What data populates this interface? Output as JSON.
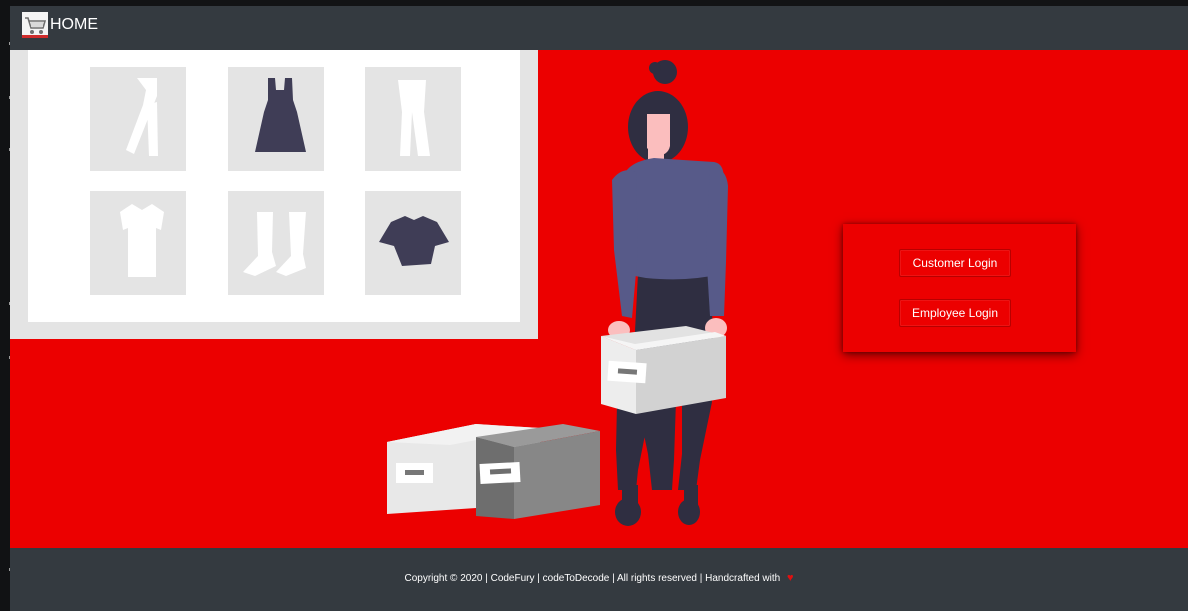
{
  "navbar": {
    "brand_label": "HOME",
    "brand_icon": "shopping-cart-icon"
  },
  "hero": {
    "illustration": "woman-carrying-boxes-wardrobe-illustration",
    "background_color": "#ec0000"
  },
  "login_panel": {
    "customer_button_label": "Customer Login",
    "employee_button_label": "Employee Login"
  },
  "footer": {
    "text": "Copyright © 2020 | CodeFury | codeToDecode | All rights reserved | Handcrafted with",
    "heart_icon": "heart-icon",
    "heart_glyph": "♥",
    "background_color": "#343a40"
  }
}
